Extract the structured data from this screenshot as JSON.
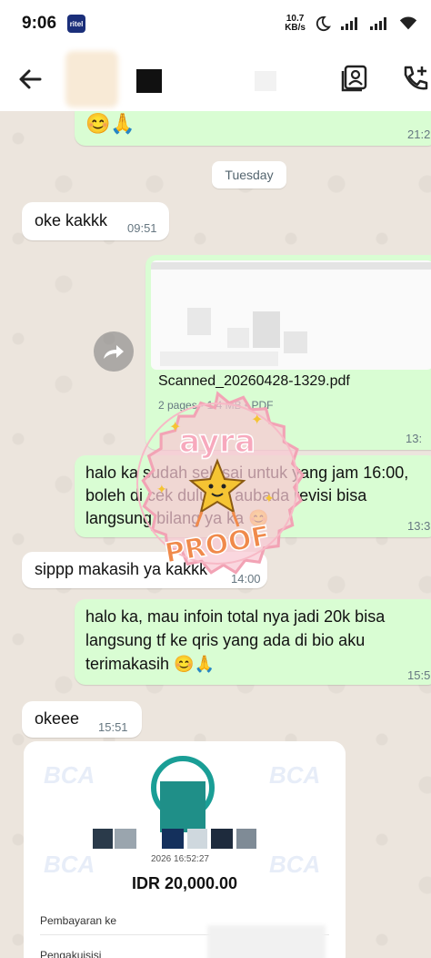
{
  "status": {
    "time": "9:06",
    "app_icon": "ritel",
    "net_speed_top": "10.7",
    "net_speed_bottom": "KB/s"
  },
  "header": {
    "back": "back-arrow-icon",
    "contact": "contact-card-icon",
    "call": "add-call-icon"
  },
  "chat": {
    "top_message_emoji": "😊🙏",
    "top_message_time": "21:2",
    "day_label": "Tuesday",
    "msg1": {
      "text": "oke kakkk",
      "time": "09:51"
    },
    "doc": {
      "name": "Scanned_20260428-1329.pdf",
      "meta": "2 pages • 1.4 MB • PDF",
      "time": "13:"
    },
    "msg2": {
      "text_lines": [
        "halo ka sudah selesai untuk yang jam 16:00,",
        "boleh di cek dulu ka aubada revisi bisa",
        "langsung bilang ya ka 😊"
      ],
      "time": "13:3"
    },
    "msg3": {
      "text": "sippp makasih ya kakkk",
      "time": "14:00"
    },
    "msg4": {
      "text_lines": [
        "halo ka, mau infoin total nya jadi 20k bisa",
        "langsung tf ke qris yang ada di bio aku",
        "terimakasih 😊🙏"
      ],
      "time": "15:5"
    },
    "msg5": {
      "text": "okeee",
      "time": "15:51"
    },
    "receipt": {
      "brand": "BCA",
      "timestamp": "2026 16:52:27",
      "amount": "IDR 20,000.00",
      "label1": "Pembayaran ke",
      "label2": "Pengakuisisi"
    }
  },
  "stamp": {
    "line1": "ayra",
    "line2": "PROOF"
  },
  "colors": {
    "outgoing": "#d9fdd3",
    "incoming": "#ffffff",
    "accent_teal": "#1a9e96",
    "stamp_pink": "#f6b6c4",
    "stamp_orange": "#f08a4b"
  }
}
